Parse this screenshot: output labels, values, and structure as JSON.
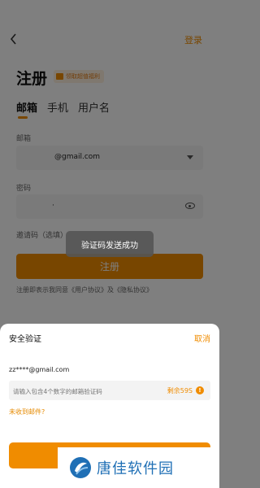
{
  "topbar": {
    "login_label": "登录"
  },
  "page": {
    "title": "注册",
    "welfare_badge": "领取超值福利",
    "tabs": [
      {
        "label": "邮箱",
        "active": true
      },
      {
        "label": "手机",
        "active": false
      },
      {
        "label": "用户名",
        "active": false
      }
    ],
    "email_label": "邮箱",
    "email_value": "@gmail.com",
    "password_label": "密码",
    "password_value": "·",
    "invite_label": "邀请码（选填）",
    "register_label": "注册",
    "agreement_text": "注册即表示我同意《用户协议》及《隐私协议》"
  },
  "toast": {
    "message": "验证码发送成功"
  },
  "sheet": {
    "title": "安全验证",
    "cancel_label": "取消",
    "masked_email": "zz****@gmail.com",
    "code_placeholder": "请输入包含4个数字的邮箱验证码",
    "countdown": "剩余59S",
    "info_icon_glyph": "!",
    "not_received_label": "未收到邮件?"
  },
  "watermark": {
    "text": "唐佳软件园"
  },
  "colors": {
    "accent": "#f08c00",
    "watermark_blue": "#1f6fb5"
  }
}
